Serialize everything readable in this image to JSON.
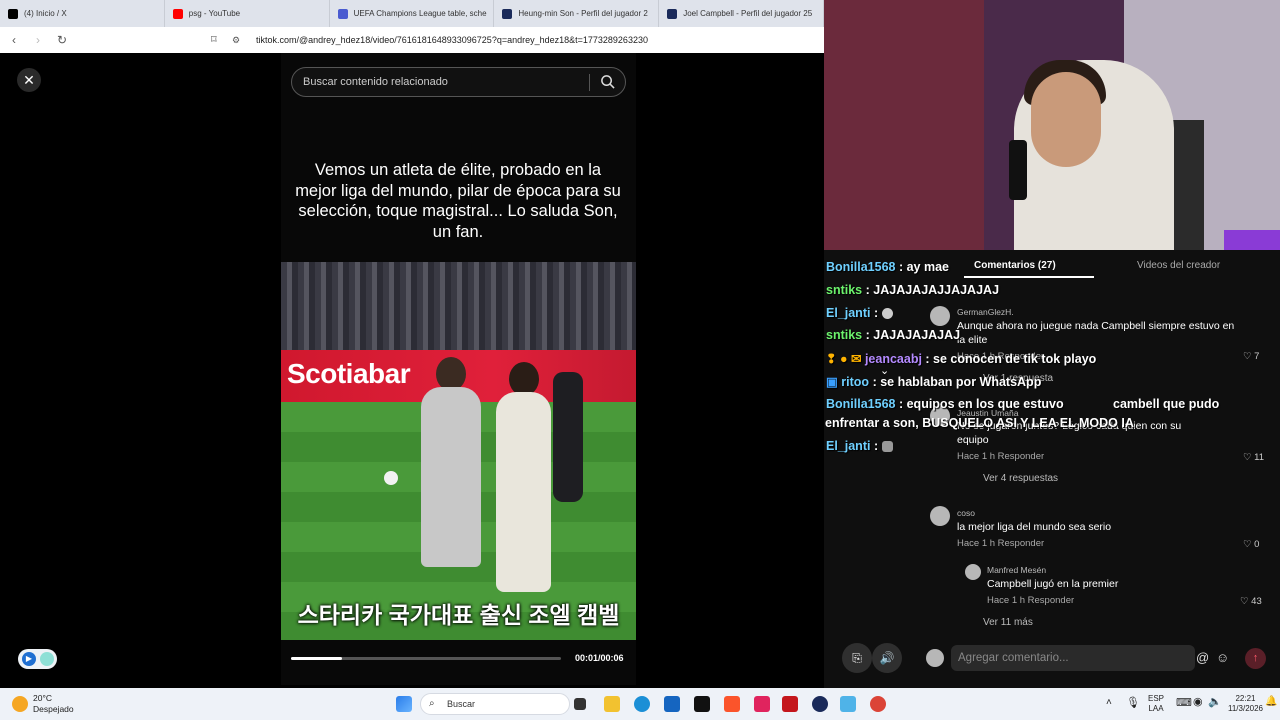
{
  "browser": {
    "tabs": [
      {
        "title": "(4) Inicio / X",
        "color": "#000000"
      },
      {
        "title": "psg - YouTube",
        "color": "#ff0000"
      },
      {
        "title": "UEFA Champions League table, sche",
        "color": "#4a5bd0"
      },
      {
        "title": "Heung-min Son - Perfil del jugador 2",
        "color": "#1a2a5a"
      },
      {
        "title": "Joel Campbell - Perfil del jugador 25",
        "color": "#1a2a5a"
      }
    ],
    "url": "tiktok.com/@andrey_hdez18/video/7616181648933096725?q=andrey_hdez18&t=1773289263230"
  },
  "video": {
    "search_placeholder": "Buscar contenido relacionado",
    "caption": "Vemos un atleta de élite, probado en la mejor liga del mundo, pilar de época para su selección, toque magistral... Lo saluda Son, un fan.",
    "banner_text": "Scotiabar",
    "korean_subtitle": "스타리카 국가대표 출신 조엘 캠벨",
    "time": "00:01/00:06",
    "progress": 0.19
  },
  "comments_panel": {
    "tab_comments": "Comentarios (27)",
    "tab_videos": "Videos del creador",
    "comments": [
      {
        "user": "GermanGlezH.",
        "text": "Aunque ahora no juegue nada Campbell siempre estuvo en la elite",
        "meta": "Hace 1 h   Responder",
        "likes": "7",
        "replies": "Ver 1 respuesta"
      },
      {
        "user": "Jeaustin Umaña",
        "text": "No se jugaron juntos? Lógico cada quien con su equipo",
        "meta": "Hace 1 h   Responder",
        "likes": "11",
        "replies": "Ver 4 respuestas"
      },
      {
        "user": "coso",
        "text": "la mejor liga del mundo sea serio",
        "meta": "Hace 1 h   Responder",
        "likes": "0",
        "replies": ""
      },
      {
        "user": "Manfred Mesén",
        "text": "Campbell jugó en la premier",
        "meta": "Hace 1 h   Responder",
        "likes": "43",
        "replies": "Ver 11 más"
      }
    ],
    "input_placeholder": "Agregar comentario..."
  },
  "chat": [
    {
      "user": "Bonilla1568",
      "msg": ": ay mae"
    },
    {
      "user": "sntiks",
      "msg": ": JAJAJAJAJJAJAJAJ"
    },
    {
      "user": "El_janti",
      "msg": ":"
    },
    {
      "user": "sntiks",
      "msg": ": JAJAJAJAJAJ"
    },
    {
      "user": "jeancaabj",
      "msg": ": se conocen de tik tok playo"
    },
    {
      "user": "ritoo",
      "msg": ": se hablaban por WhatsApp"
    },
    {
      "user": "Bonilla1568",
      "msg": ": equipos en los que estuvo"
    },
    {
      "user": "",
      "msg": "cambell que pudo"
    },
    {
      "user": "",
      "msg": "enfrentar a son, BUSQUELO ASI Y LEA EL MODO IA"
    },
    {
      "user": "El_janti",
      "msg": ":"
    }
  ],
  "taskbar": {
    "weather_temp": "20°C",
    "weather_desc": "Despejado",
    "search": "Buscar",
    "lang1": "ESP",
    "lang2": "LAA",
    "time": "22:21",
    "date": "11/3/2026"
  }
}
